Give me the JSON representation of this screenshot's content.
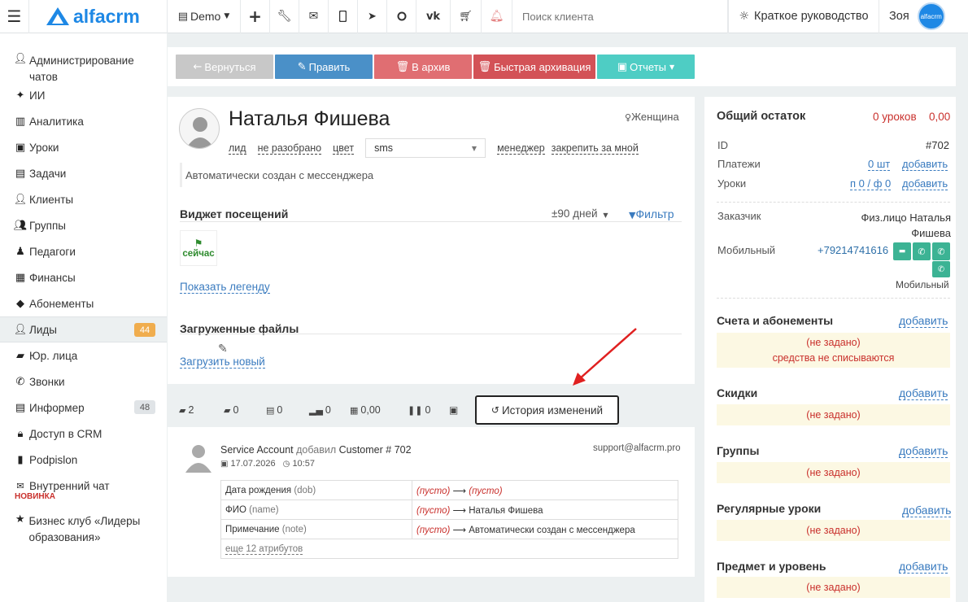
{
  "topbar": {
    "logo_text": "alfacrm",
    "branch": "Demo",
    "search_placeholder": "Поиск клиента",
    "guide": "Краткое руководство",
    "user": "Зоя",
    "avatar_text": "alfacrm"
  },
  "sidebar": {
    "items": [
      {
        "label": "Администрирование чатов",
        "icon": "user-icon"
      },
      {
        "label": "ИИ",
        "icon": "sparkle-icon"
      },
      {
        "label": "Аналитика",
        "icon": "map-icon"
      },
      {
        "label": "Уроки",
        "icon": "calendar-icon"
      },
      {
        "label": "Задачи",
        "icon": "clipboard-icon"
      },
      {
        "label": "Клиенты",
        "icon": "user-icon"
      },
      {
        "label": "Группы",
        "icon": "users-icon"
      },
      {
        "label": "Педагоги",
        "icon": "teacher-icon"
      },
      {
        "label": "Финансы",
        "icon": "money-icon"
      },
      {
        "label": "Абонементы",
        "icon": "tag-icon"
      },
      {
        "label": "Лиды",
        "icon": "user-icon",
        "badge": "44"
      },
      {
        "label": "Юр. лица",
        "icon": "briefcase-icon"
      },
      {
        "label": "Звонки",
        "icon": "phone-icon"
      },
      {
        "label": "Информер",
        "icon": "inbox-icon",
        "badge": "48"
      },
      {
        "label": "Доступ в CRM",
        "icon": "lock-icon"
      },
      {
        "label": "Podpislon",
        "icon": "file-icon"
      },
      {
        "label": "Внутренний чат",
        "icon": "mail-icon",
        "tag": "НОВИНКА"
      },
      {
        "label": "Бизнес клуб «Лидеры образования»",
        "icon": "star-icon"
      }
    ]
  },
  "actions": {
    "back": "Вернуться",
    "edit": "Править",
    "archive": "В архив",
    "quick_archive": "Быстрая архивация",
    "reports": "Отчеты"
  },
  "profile": {
    "name": "Наталья Фишева",
    "gender": "Женщина",
    "status_lead": "лид",
    "status": "не разобрано",
    "color_label": "цвет",
    "source": "sms",
    "manager_label": "менеджер",
    "assign_me": "закрепить за мной",
    "note": "Автоматически создан с мессенджера",
    "visits_title": "Виджет посещений",
    "visits_period": "±90 дней",
    "filter": "Фильтр",
    "now": "сейчас",
    "show_legend": "Показать легенду",
    "files_title": "Загруженные файлы",
    "upload_new": "Загрузить новый"
  },
  "tabs": {
    "comments": "2",
    "bookmarks": "0",
    "docs": "0",
    "stats": "0",
    "gifts": "0,00",
    "pause": "0",
    "history": "История изменений"
  },
  "history": {
    "actor": "Service Account",
    "action": "добавил",
    "target": "Customer # 702",
    "email": "support@alfacrm.pro",
    "date": "17.07.2026",
    "time": "10:57",
    "rows": [
      {
        "field": "Дата рождения",
        "key": "(dob)",
        "old": "(пусто)",
        "new": "(пусто)"
      },
      {
        "field": "ФИО",
        "key": "(name)",
        "old": "(пусто)",
        "new": "Наталья Фишева"
      },
      {
        "field": "Примечание",
        "key": "(note)",
        "old": "(пусто)",
        "new": "Автоматически создан с мессенджера"
      }
    ],
    "more": "еще 12 атрибутов"
  },
  "right": {
    "balance_title": "Общий остаток",
    "balance_lessons": "0 уроков",
    "balance_sum": "0,00",
    "id_label": "ID",
    "id_value": "#702",
    "payments_label": "Платежи",
    "payments_value": "0 шт",
    "lessons_label": "Уроки",
    "lessons_value": "п 0 / ф 0",
    "add": "добавить",
    "customer_label": "Заказчик",
    "customer_value": "Физ.лицо Наталья Фишева",
    "mobile_label": "Мобильный",
    "mobile_value": "+79214741616",
    "mobile_caption": "Мобильный",
    "invoices_title": "Счета и абонементы",
    "not_set": "(не задано)",
    "not_charged": "средства не списываются",
    "discounts_title": "Скидки",
    "groups_title": "Группы",
    "regular_title": "Регулярные уроки",
    "subject_title": "Предмет и уровень"
  },
  "colors": {
    "accent": "#3a7bbf",
    "gray_btn": "#c8c8c8",
    "blue_btn": "#4a90c8",
    "red_btn": "#e06e72",
    "darkred_btn": "#d35257",
    "teal_btn": "#4ecdc4",
    "orange_badge": "#f0ad4e",
    "green": "#5cb85c",
    "red_text": "#c9302c"
  }
}
